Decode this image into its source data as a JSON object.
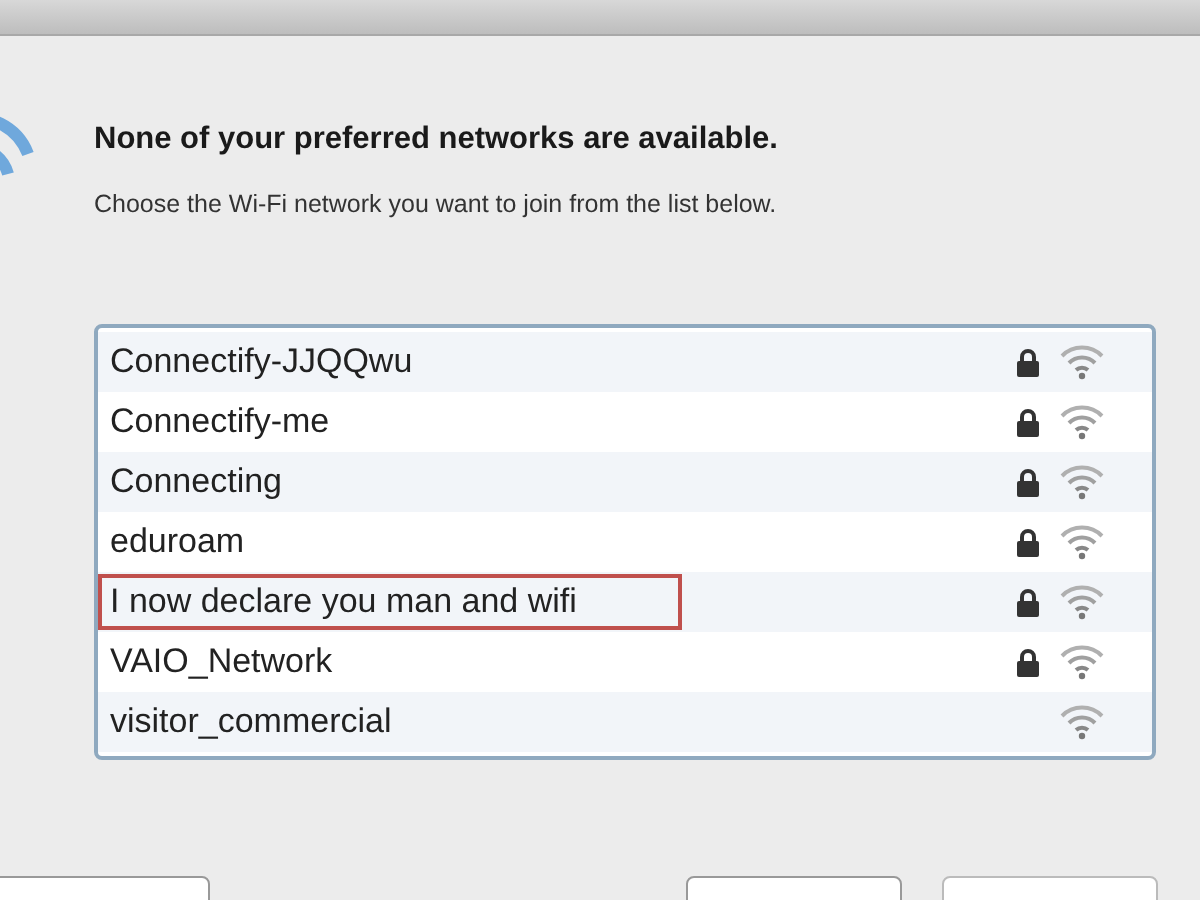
{
  "dialog": {
    "heading": "None of your preferred networks are available.",
    "message": "Choose the Wi-Fi network you want to join from the list below."
  },
  "networks": [
    {
      "name": "Connectify-JJQQwu",
      "locked": true,
      "highlighted": false
    },
    {
      "name": "Connectify-me",
      "locked": true,
      "highlighted": false
    },
    {
      "name": "Connecting",
      "locked": true,
      "highlighted": false
    },
    {
      "name": "eduroam",
      "locked": true,
      "highlighted": false
    },
    {
      "name": "I now declare you man and wifi",
      "locked": true,
      "highlighted": true
    },
    {
      "name": "VAIO_Network",
      "locked": true,
      "highlighted": false
    },
    {
      "name": "visitor_commercial",
      "locked": false,
      "highlighted": false
    }
  ]
}
